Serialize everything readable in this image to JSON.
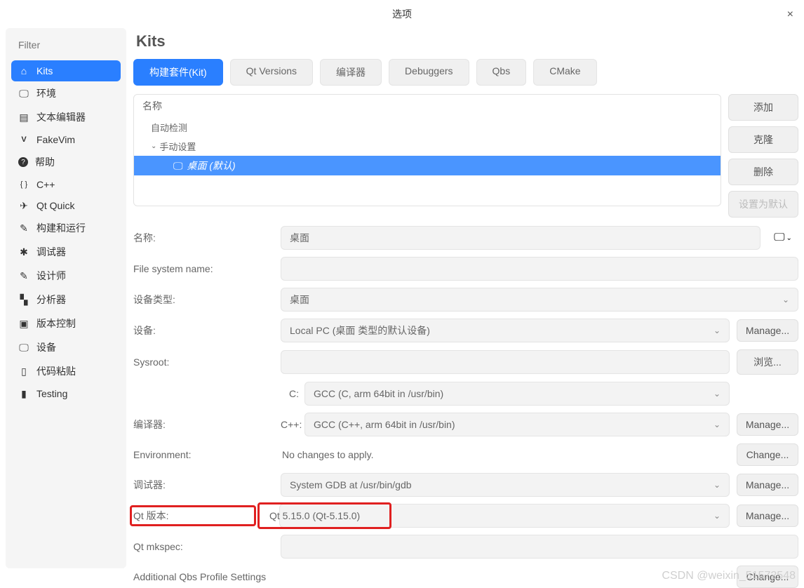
{
  "window": {
    "title": "选项",
    "close": "×"
  },
  "sidebar": {
    "filter_ph": "Filter",
    "items": [
      {
        "label": "Kits",
        "icon": "⌂"
      },
      {
        "label": "环境",
        "icon": "□"
      },
      {
        "label": "文本编辑器",
        "icon": "▤"
      },
      {
        "label": "FakeVim",
        "icon": "V"
      },
      {
        "label": "帮助",
        "icon": "?"
      },
      {
        "label": "C++",
        "icon": "{ }"
      },
      {
        "label": "Qt Quick",
        "icon": "✈"
      },
      {
        "label": "构建和运行",
        "icon": "✎"
      },
      {
        "label": "调试器",
        "icon": "✱"
      },
      {
        "label": "设计师",
        "icon": "✎"
      },
      {
        "label": "分析器",
        "icon": "▚"
      },
      {
        "label": "版本控制",
        "icon": "▣"
      },
      {
        "label": "设备",
        "icon": "□"
      },
      {
        "label": "代码粘贴",
        "icon": "▯"
      },
      {
        "label": "Testing",
        "icon": "▮"
      }
    ]
  },
  "content_title": "Kits",
  "tabs": [
    "构建套件(Kit)",
    "Qt Versions",
    "编译器",
    "Debuggers",
    "Qbs",
    "CMake"
  ],
  "kit_list": {
    "header": "名称",
    "auto_group": "自动检测",
    "manual_group": "手动设置",
    "selected_kit": "桌面 (默认)"
  },
  "kit_buttons": {
    "add": "添加",
    "clone": "克隆",
    "remove": "删除",
    "default": "设置为默认"
  },
  "form": {
    "name_lbl": "名称:",
    "name_val": "桌面",
    "fs_lbl": "File system name:",
    "devtype_lbl": "设备类型:",
    "devtype_val": "桌面",
    "device_lbl": "设备:",
    "device_val": "Local PC (桌面 类型的默认设备)",
    "sysroot_lbl": "Sysroot:",
    "compiler_lbl": "编译器:",
    "c_lbl": "C:",
    "c_val": "GCC (C, arm 64bit in /usr/bin)",
    "cpp_lbl": "C++:",
    "cpp_val": "GCC (C++, arm 64bit in /usr/bin)",
    "env_lbl": "Environment:",
    "env_val": "No changes to apply.",
    "dbg_lbl": "调试器:",
    "dbg_val": "System GDB at /usr/bin/gdb",
    "qt_lbl": "Qt 版本:",
    "qt_val": "Qt 5.15.0 (Qt-5.15.0)",
    "mkspec_lbl": "Qt mkspec:",
    "qbs_lbl": "Additional Qbs Profile Settings"
  },
  "btns": {
    "manage": "Manage...",
    "browse": "浏览...",
    "change": "Change..."
  },
  "watermark": "CSDN @weixin_51572548"
}
